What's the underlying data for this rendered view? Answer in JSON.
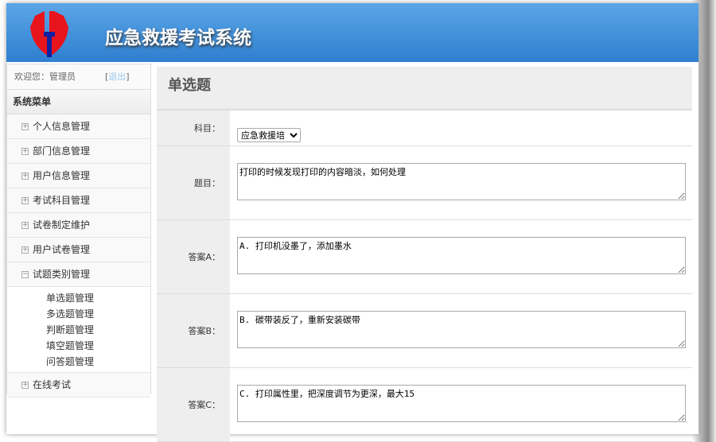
{
  "header": {
    "title": "应急救援考试系统"
  },
  "sidebar": {
    "welcome": "欢迎您：管理员",
    "logout": "退出",
    "menu_title": "系统菜单",
    "items": [
      {
        "label": "个人信息管理"
      },
      {
        "label": "部门信息管理"
      },
      {
        "label": "用户信息管理"
      },
      {
        "label": "考试科目管理"
      },
      {
        "label": "试卷制定维护"
      },
      {
        "label": "用户试卷管理"
      },
      {
        "label": "试题类别管理"
      }
    ],
    "subitems": [
      {
        "label": "单选题管理"
      },
      {
        "label": "多选题管理"
      },
      {
        "label": "判断题管理"
      },
      {
        "label": "填空题管理"
      },
      {
        "label": "问答题管理"
      }
    ],
    "last_item": {
      "label": "在线考试"
    }
  },
  "main": {
    "page_title": "单选题",
    "subject": {
      "label": "科目：",
      "value": "应急救援培"
    },
    "question": {
      "label": "题目：",
      "value": "打印的时候发现打印的内容暗淡，如何处理"
    },
    "answer_a": {
      "label": "答案A：",
      "value": "A. 打印机没墨了，添加墨水"
    },
    "answer_b": {
      "label": "答案B：",
      "value": "B. 碳带装反了，重新安装碳带"
    },
    "answer_c": {
      "label": "答案C：",
      "value": "C. 打印属性里，把深度调节为更深，最大15"
    }
  }
}
